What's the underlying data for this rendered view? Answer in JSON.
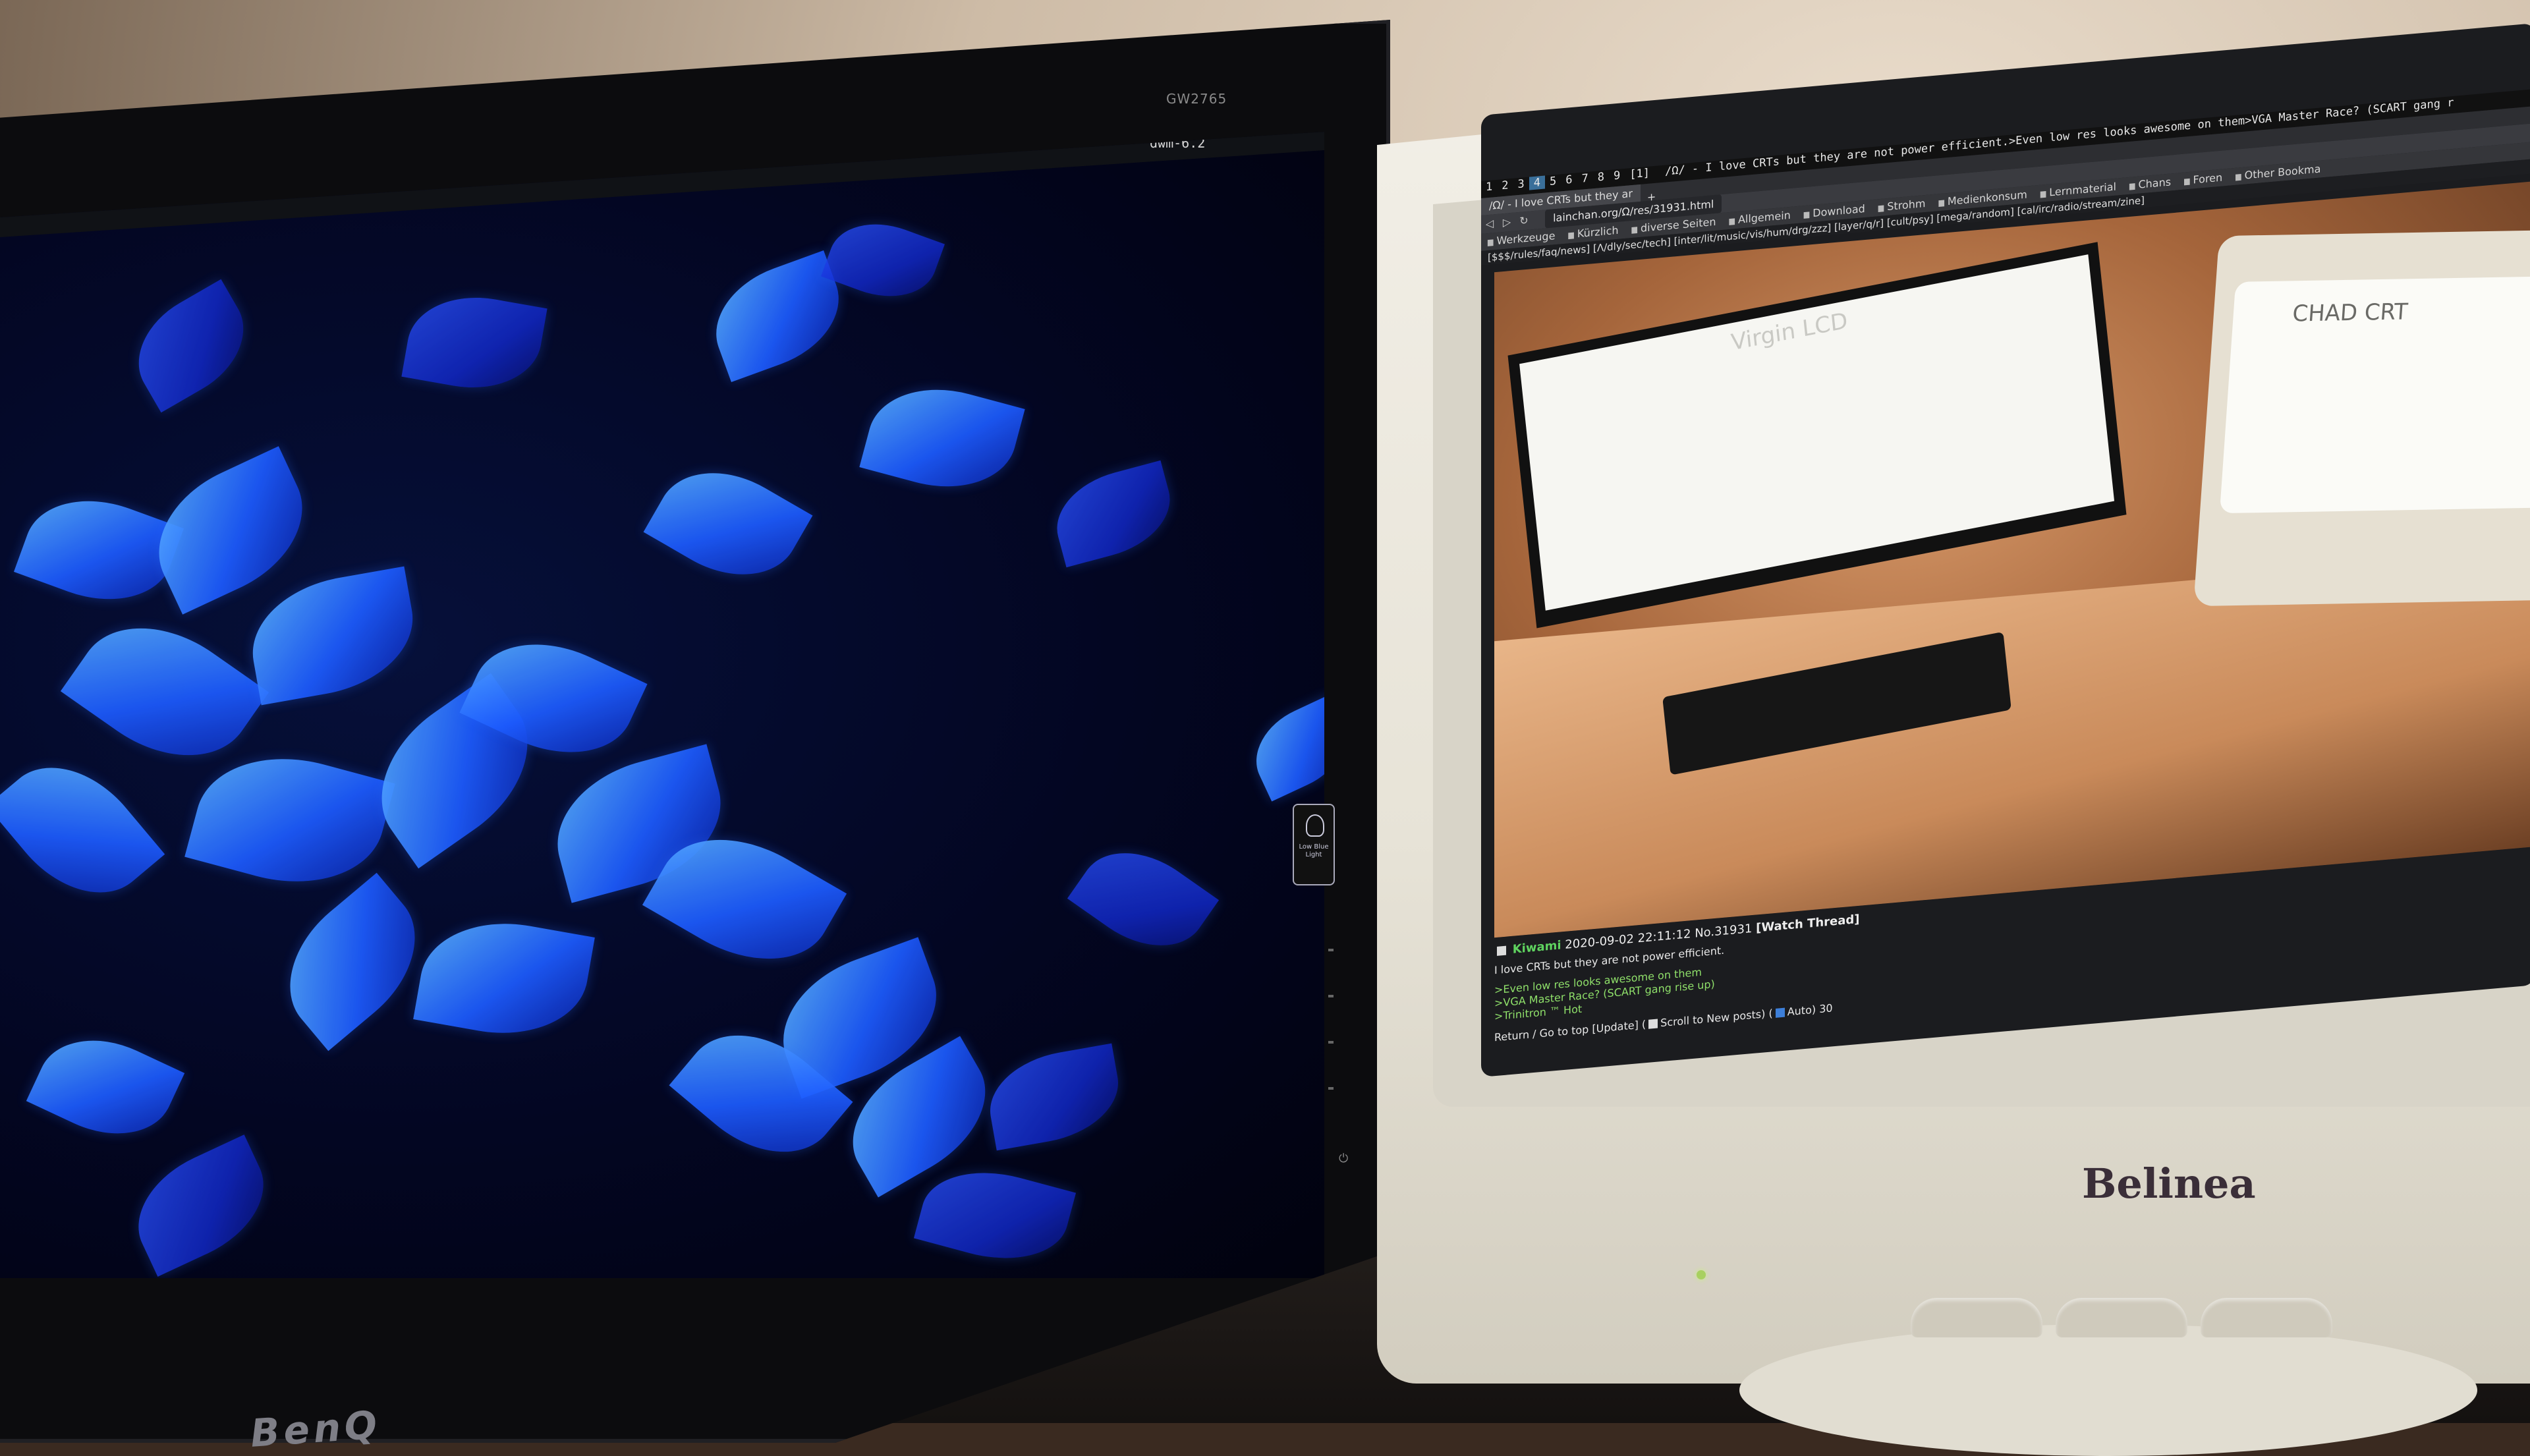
{
  "benq": {
    "model_label": "GW2765",
    "dwm_status": "dwm-6.2",
    "low_blue_light_label": "Low Blue Light",
    "brand": "BenQ"
  },
  "crt": {
    "dwm_tags": [
      "1",
      "2",
      "3",
      "4",
      "5",
      "6",
      "7",
      "8",
      "9"
    ],
    "dwm_layout": "[1]",
    "window_title": "/Ω/ - I love CRTs but they are not power efficient.>Even low res looks awesome on them>VGA Master Race? (SCART gang r",
    "tab_title": "/Ω/ - I love CRTs but they ar",
    "new_tab": "+",
    "url": "lainchan.org/Ω/res/31931.html",
    "bookmarks": [
      "Werkzeuge",
      "Kürzlich",
      "diverse Seiten",
      "Allgemein",
      "Download",
      "Strohm",
      "Medienkonsum",
      "Lernmaterial",
      "Chans",
      "Foren",
      "Other Bookma"
    ],
    "board_nav": "[$$$/rules/faq/news] [Λ/dly/sec/tech] [inter/lit/music/vis/hum/drg/zzz] [layer/q/r] [cult/psy] [mega/random] [cal/irc/radio/stream/zine]",
    "post": {
      "name": "Kiwami",
      "date": "2020-09-02 22:11:12",
      "number": "No.31931",
      "watch": "[Watch Thread]",
      "line1": "I love CRTs but they are not power efficient.",
      "green1": ">Even low res looks awesome on them",
      "green2": ">VGA Master Race? (SCART gang rise up)",
      "green3": ">Trinitron ™ Hot"
    },
    "image": {
      "lcd_label": "Virgin LCD",
      "crt_label": "CHAD CRT"
    },
    "footer": {
      "return": "Return /",
      "go_top": "Go to top",
      "update": "[Update] (",
      "scroll_new": "Scroll to New posts) (",
      "auto": "Auto) 30"
    },
    "brand": "Belinea"
  }
}
